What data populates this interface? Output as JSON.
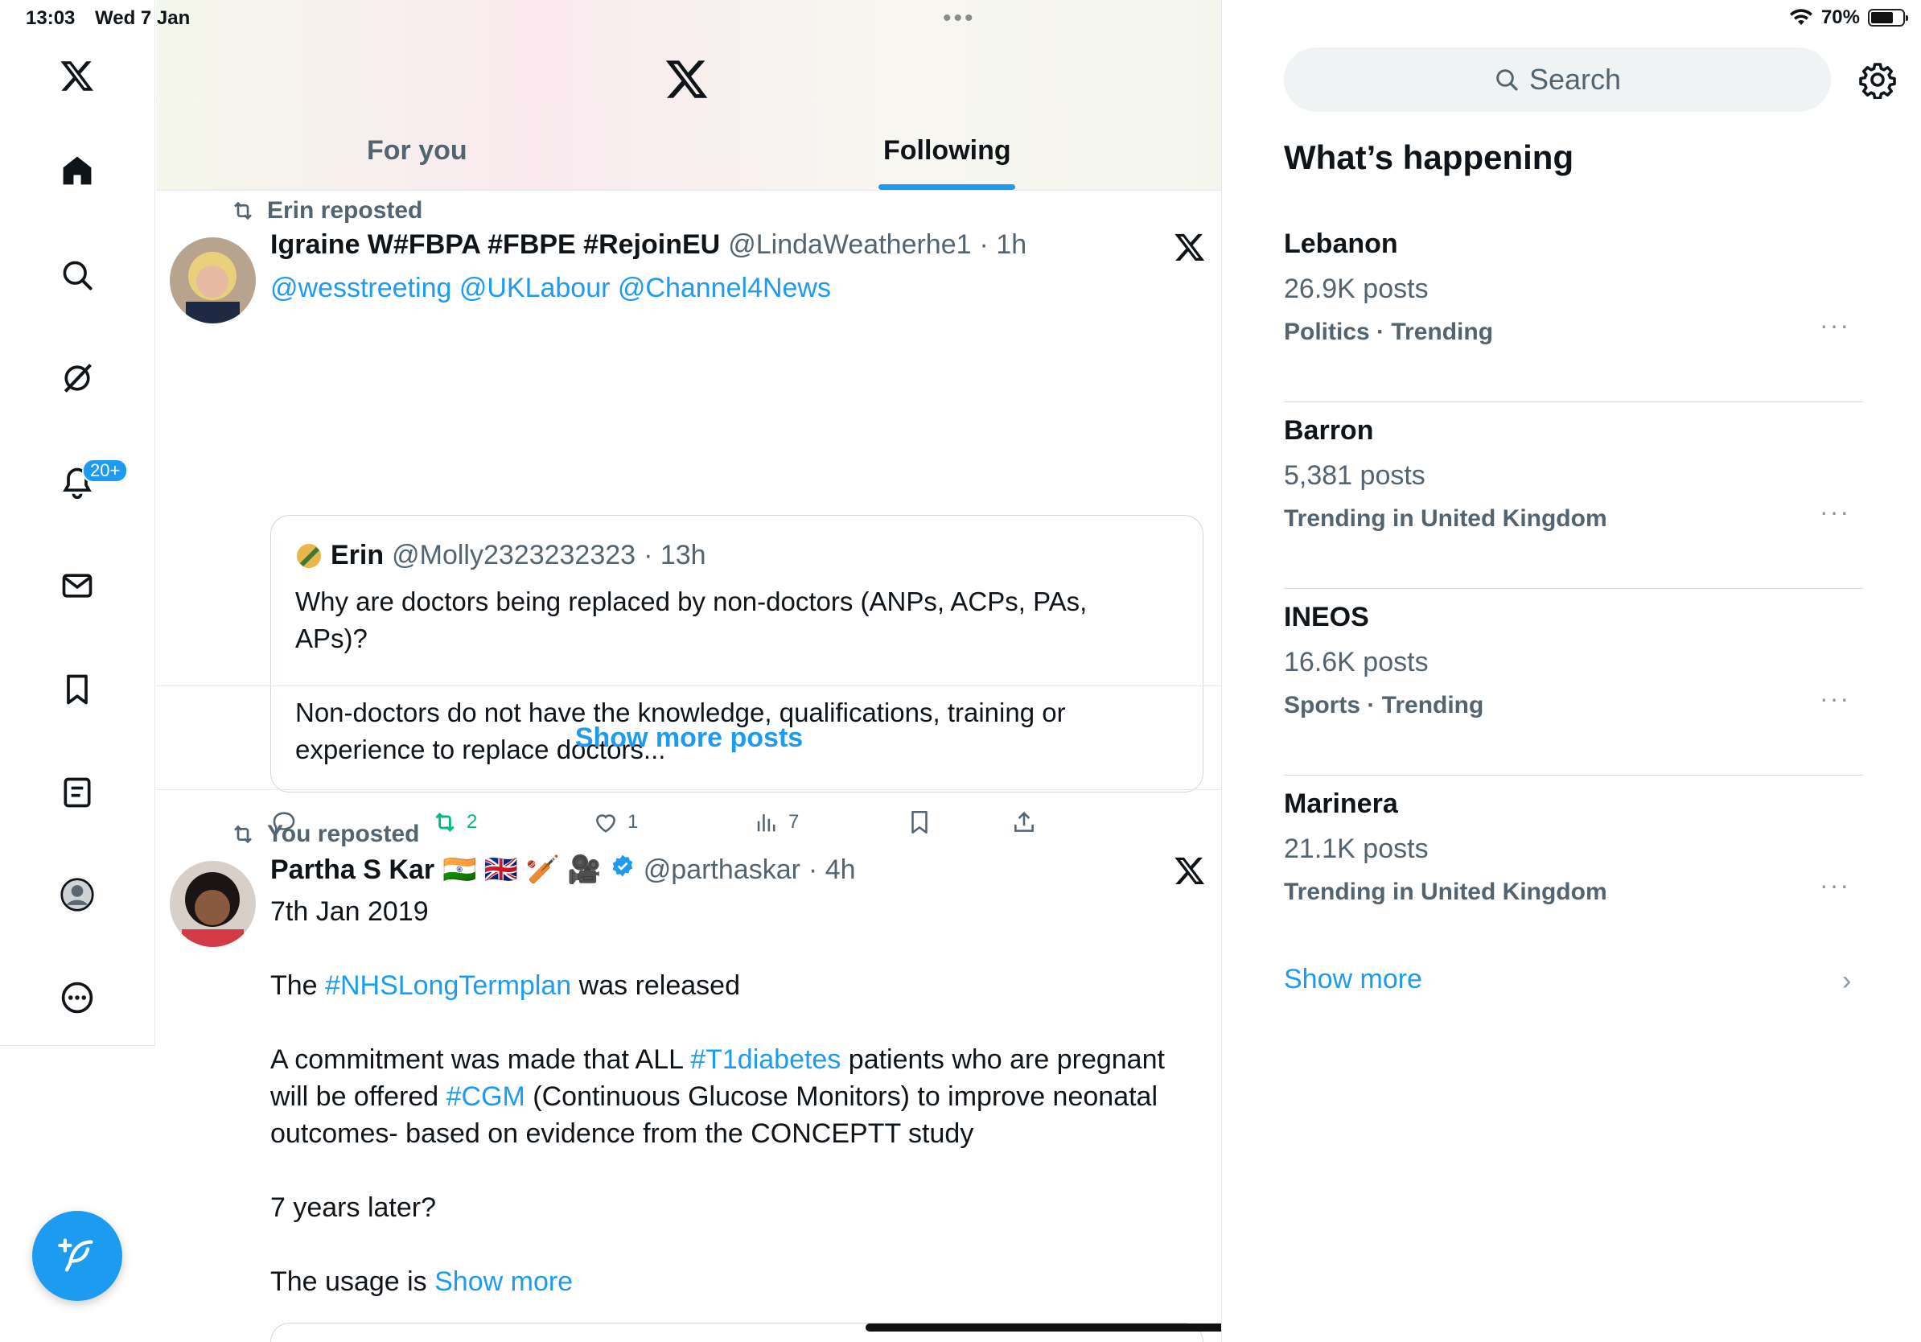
{
  "status_bar": {
    "time": "13:03",
    "date": "Wed 7 Jan",
    "battery": "70%"
  },
  "nav": {
    "notifications_badge": "20+"
  },
  "tabs": [
    {
      "label": "For you"
    },
    {
      "label": "Following"
    }
  ],
  "posts": [
    {
      "repost_by": "Erin reposted",
      "name": "Igraine W#FBPA #FBPE #RejoinEU",
      "handle": "@LindaWeatherhe1",
      "time": "· 1h",
      "mentions": "@wesstreeting @UKLabour @Channel4News",
      "quote": {
        "name": "Erin",
        "handle": "@Molly2323232323",
        "time": "· 13h",
        "line1": "Why are doctors being replaced by non-doctors (ANPs, ACPs, PAs,",
        "line2": "APs)?",
        "line3": "Non-doctors do not have the knowledge, qualifications, training or",
        "line4": "experience to replace  doctors..."
      },
      "reposts": "2",
      "likes": "1",
      "views": "7"
    },
    {
      "repost_by": "You reposted",
      "name": "Partha S Kar",
      "emoji": "🇮🇳 🇬🇧 🏏 🎥",
      "handle": "@parthaskar",
      "time": "· 4h",
      "date_line": "7th Jan 2019",
      "p1_pre": "The ",
      "p1_tag": "#NHSLongTermplan",
      "p1_post": " was released",
      "p2_pre": "A commitment was made that ALL ",
      "p2_tag1": "#T1diabetes",
      "p2_mid": " patients who are pregnant",
      "p2_line2_pre": "will be offered ",
      "p2_tag2": "#CGM",
      "p2_line2_post": " (Continuous Glucose Monitors) to improve neonatal",
      "p2_line3": "outcomes- based on evidence from the CONCEPTT study",
      "p3": "7 years later?",
      "p4_pre": "The usage is ",
      "p4_link": "Show more"
    }
  ],
  "show_more_posts": "Show more posts",
  "sidebar": {
    "search_placeholder": "Search",
    "section_title": "What’s happening",
    "trends": [
      {
        "name": "Lebanon",
        "count": "26.9K posts",
        "category": "Politics · Trending"
      },
      {
        "name": "Barron",
        "count": "5,381 posts",
        "category": "Trending in United Kingdom"
      },
      {
        "name": "INEOS",
        "count": "16.6K posts",
        "category": "Sports · Trending"
      },
      {
        "name": "Marinera",
        "count": "21.1K posts",
        "category": "Trending in United Kingdom"
      }
    ],
    "more_glyph": "···",
    "show_more": "Show more"
  },
  "colors": {
    "accent": "#1d9bf0",
    "repost_green": "#00ba7c",
    "secondary_text": "#536471"
  }
}
